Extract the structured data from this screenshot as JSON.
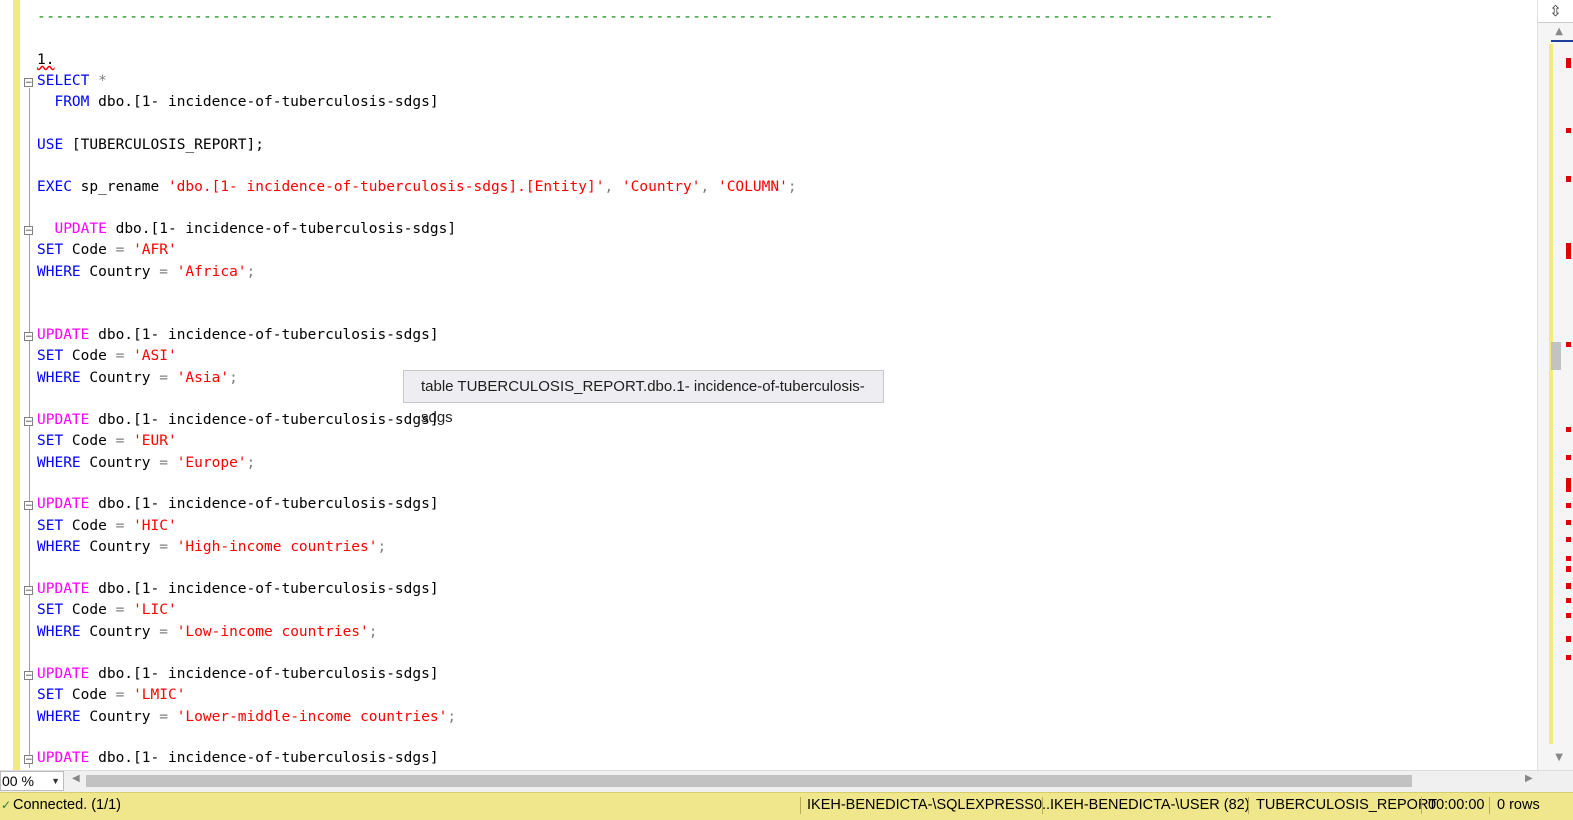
{
  "editor": {
    "separator": "--------------------------------------------------------------------------------------------------------------------------------------",
    "step_label": "1.",
    "select_kw": "SELECT",
    "select_star": " *",
    "from_kw": "FROM",
    "table_ref": " dbo.[1- incidence-of-tuberculosis-sdgs]",
    "use_kw": "USE",
    "use_db": " [TUBERCULOSIS_REPORT];",
    "exec_kw": "EXEC",
    "exec_proc": " sp_rename ",
    "exec_arg1": "'dbo.[1- incidence-of-tuberculosis-sdgs].[Entity]'",
    "exec_arg2": "'Country'",
    "exec_arg3": "'COLUMN'",
    "update_kw": "UPDATE",
    "set_kw": "SET",
    "where_kw": "WHERE",
    "code_col": " Code ",
    "country_col": " Country ",
    "updates": [
      {
        "code": "'AFR'",
        "country": "'Africa'"
      },
      {
        "code": "'ASI'",
        "country": "'Asia'"
      },
      {
        "code": "'EUR'",
        "country": "'Europe'"
      },
      {
        "code": "'HIC'",
        "country": "'High-income countries'"
      },
      {
        "code": "'LIC'",
        "country": "'Low-income countries'"
      },
      {
        "code": "'LMIC'",
        "country": "'Lower-middle-income countries'"
      }
    ]
  },
  "tooltip": "table TUBERCULOSIS_REPORT.dbo.1- incidence-of-tuberculosis-sdgs",
  "zoom": "00 %",
  "status": {
    "connection": "Connected. (1/1)",
    "server": "IKEH-BENEDICTA-\\SQLEXPRESS0...",
    "user": "IKEH-BENEDICTA-\\USER (82)",
    "database": "TUBERCULOSIS_REPORT",
    "elapsed": "00:00:00",
    "rows": "0 rows"
  },
  "colors": {
    "keyword": "#0000ff",
    "update_keyword": "#ff00ff",
    "string": "#ff0000",
    "comment": "#008000",
    "status_bar": "#f0e68c"
  }
}
